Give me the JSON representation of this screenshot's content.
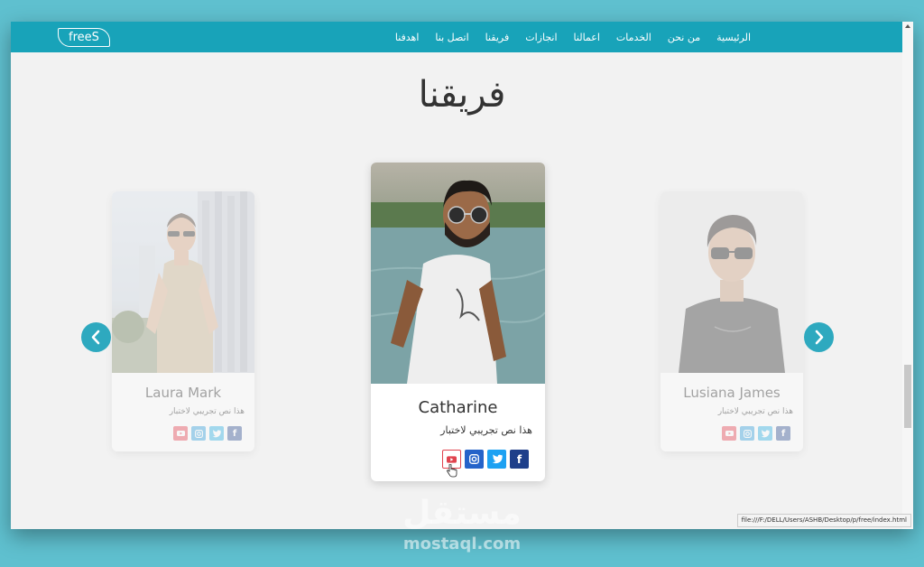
{
  "nav": {
    "logo": "freeS",
    "links": [
      "الرئيسية",
      "من نحن",
      "الخدمات",
      "اعمالنا",
      "انجازات",
      "فريقنا",
      "اتصل بنا",
      "اهدفنا"
    ]
  },
  "section": {
    "title": "فريقنا"
  },
  "team": [
    {
      "name": "Laura Mark",
      "desc": "هذا نص تجريبي لاختبار",
      "socials": [
        "facebook-icon",
        "twitter-icon",
        "instagram-icon",
        "youtube-icon"
      ]
    },
    {
      "name": "Catharine",
      "desc": "هذا نص تجريبي لاختبار",
      "socials": [
        "facebook-icon",
        "twitter-icon",
        "instagram-icon",
        "youtube-icon"
      ]
    },
    {
      "name": "Lusiana James",
      "desc": "هذا نص تجريبي لاختبار",
      "socials": [
        "facebook-icon",
        "twitter-icon",
        "instagram-icon",
        "youtube-icon"
      ]
    }
  ],
  "carousel": {
    "prev_icon": "chevron-left-icon",
    "next_icon": "chevron-right-icon"
  },
  "status_url": "file:///F:/DELL/Users/ASHB/Desktop/p/free/index.html",
  "watermark": {
    "arabic": "مستقل",
    "latin": "mostaql.com"
  },
  "colors": {
    "primary": "#18a3b9",
    "background": "#5fc0cf",
    "page": "#f2f2f2"
  }
}
